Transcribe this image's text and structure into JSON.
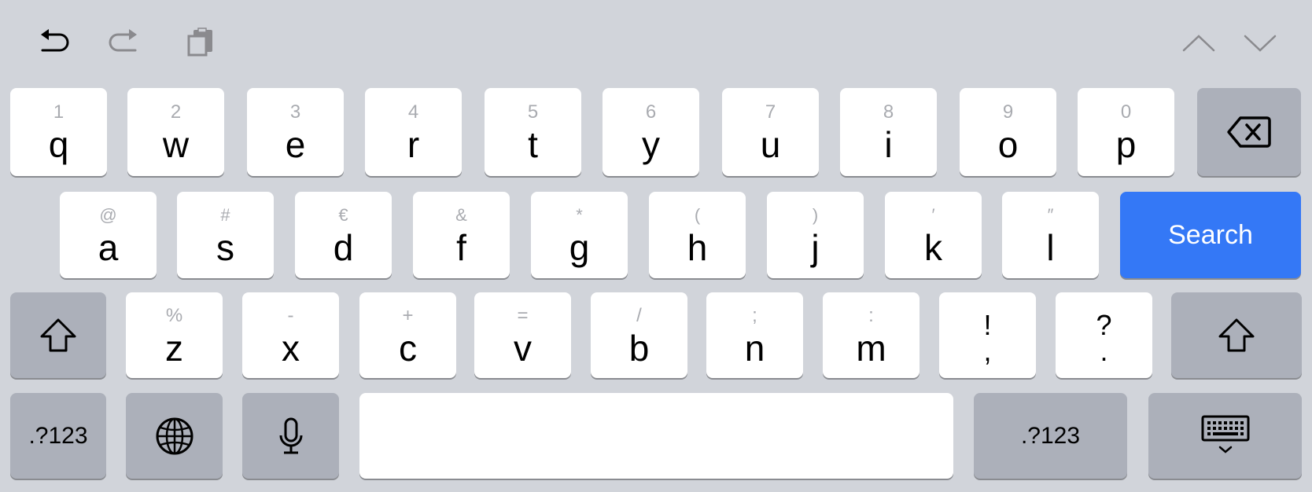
{
  "toolbar": {
    "left": [
      {
        "icon": "undo-icon",
        "enabled": true
      },
      {
        "icon": "redo-icon",
        "enabled": false
      },
      {
        "icon": "paste-icon",
        "enabled": false
      }
    ],
    "right": [
      {
        "icon": "chevron-up-icon"
      },
      {
        "icon": "chevron-down-icon"
      }
    ]
  },
  "rows": {
    "row1": [
      {
        "pri": "q",
        "sec": "1"
      },
      {
        "pri": "w",
        "sec": "2"
      },
      {
        "pri": "e",
        "sec": "3"
      },
      {
        "pri": "r",
        "sec": "4"
      },
      {
        "pri": "t",
        "sec": "5"
      },
      {
        "pri": "y",
        "sec": "6"
      },
      {
        "pri": "u",
        "sec": "7"
      },
      {
        "pri": "i",
        "sec": "8"
      },
      {
        "pri": "o",
        "sec": "9"
      },
      {
        "pri": "p",
        "sec": "0"
      }
    ],
    "row2": [
      {
        "pri": "a",
        "sec": "@"
      },
      {
        "pri": "s",
        "sec": "#"
      },
      {
        "pri": "d",
        "sec": "€"
      },
      {
        "pri": "f",
        "sec": "&"
      },
      {
        "pri": "g",
        "sec": "*"
      },
      {
        "pri": "h",
        "sec": "("
      },
      {
        "pri": "j",
        "sec": ")"
      },
      {
        "pri": "k",
        "sec": "′"
      },
      {
        "pri": "l",
        "sec": "″"
      }
    ],
    "row3": [
      {
        "pri": "z",
        "sec": "%"
      },
      {
        "pri": "x",
        "sec": "-"
      },
      {
        "pri": "c",
        "sec": "+"
      },
      {
        "pri": "v",
        "sec": "="
      },
      {
        "pri": "b",
        "sec": "/"
      },
      {
        "pri": "n",
        "sec": ";"
      },
      {
        "pri": "m",
        "sec": ":"
      }
    ],
    "row3_punct": [
      {
        "top": "!",
        "bottom": ","
      },
      {
        "top": "?",
        "bottom": "."
      }
    ]
  },
  "keys": {
    "delete": {
      "icon": "delete-icon"
    },
    "search": {
      "label": "Search"
    },
    "shift": {
      "icon": "shift-icon"
    },
    "numbers_left": {
      "label": ".?123"
    },
    "globe": {
      "icon": "globe-icon"
    },
    "mic": {
      "icon": "microphone-icon"
    },
    "space": {
      "label": ""
    },
    "numbers_right": {
      "label": ".?123"
    },
    "dismiss": {
      "icon": "keyboard-dismiss-icon"
    }
  },
  "colors": {
    "background": "#d1d4da",
    "key": "#ffffff",
    "function_key": "#acb0ba",
    "accent": "#3478f6"
  }
}
